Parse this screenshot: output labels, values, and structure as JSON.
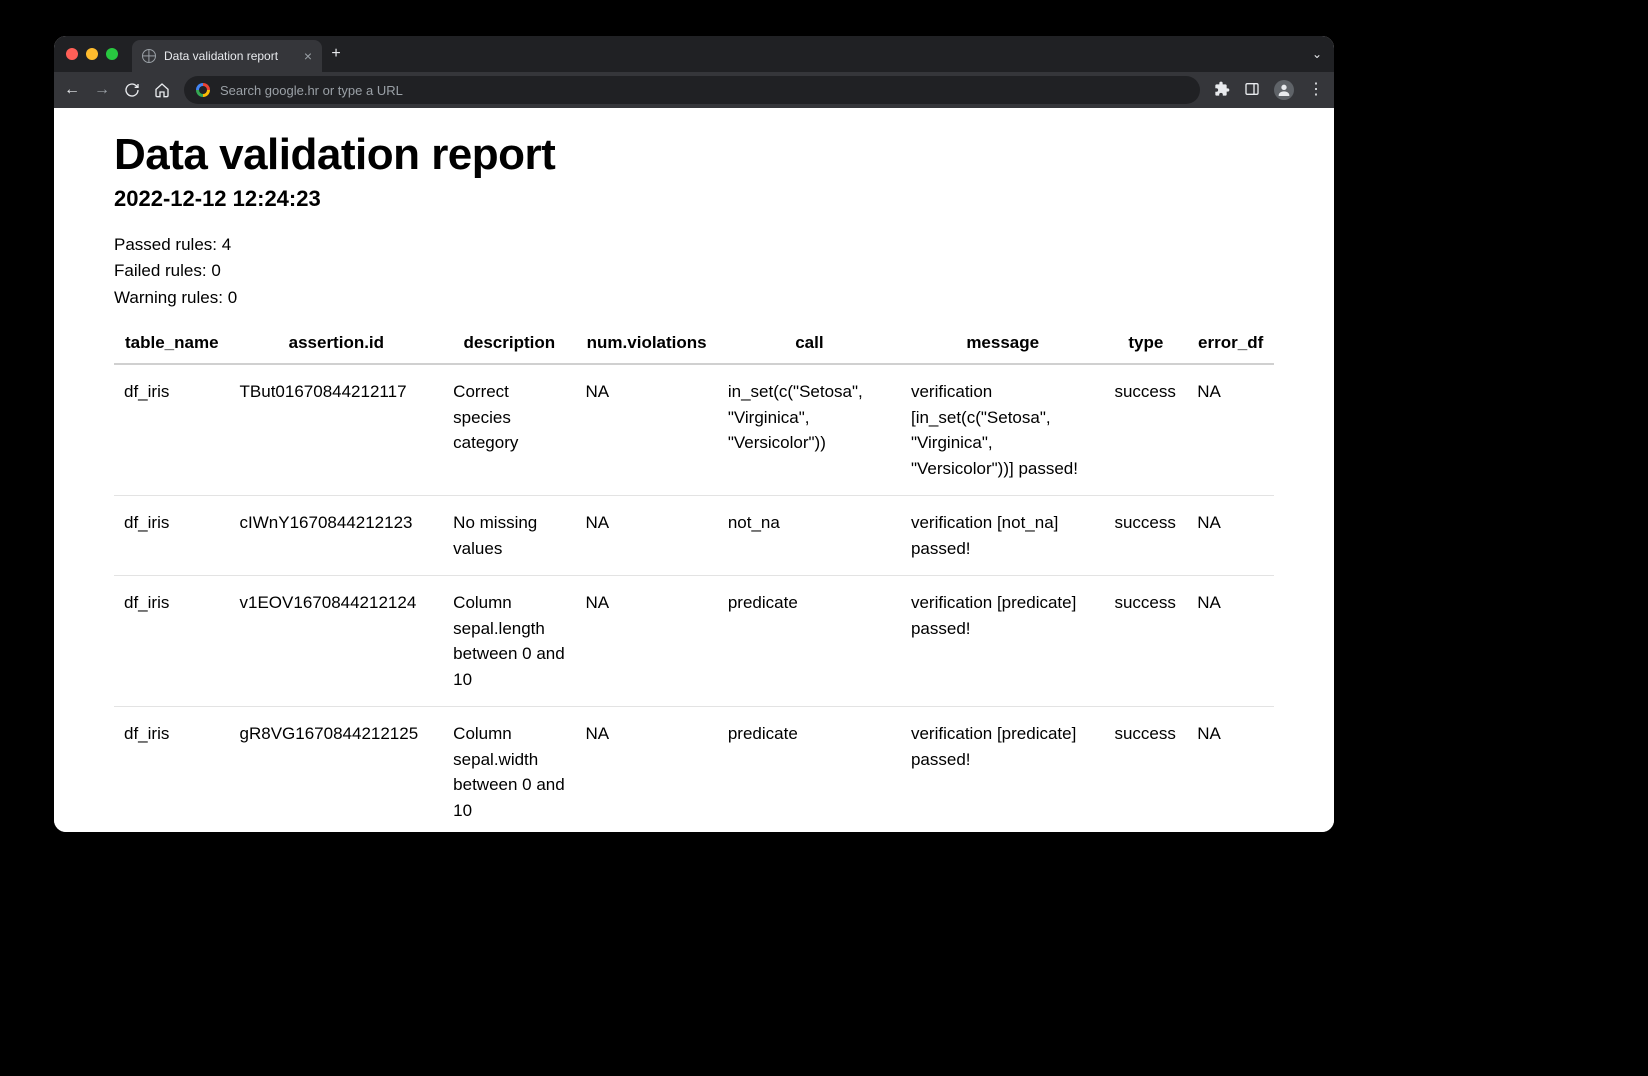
{
  "browser": {
    "tab_title": "Data validation report",
    "omnibox_placeholder": "Search google.hr or type a URL"
  },
  "report": {
    "title": "Data validation report",
    "timestamp": "2022-12-12 12:24:23",
    "summary": {
      "passed_label": "Passed rules: 4",
      "failed_label": "Failed rules: 0",
      "warning_label": "Warning rules: 0"
    },
    "columns": [
      "table_name",
      "assertion.id",
      "description",
      "num.violations",
      "call",
      "message",
      "type",
      "error_df"
    ],
    "rows": [
      {
        "table_name": "df_iris",
        "assertion_id": "TBut01670844212117",
        "description": "Correct species category",
        "num_violations": "NA",
        "call": "in_set(c(\"Setosa\", \"Virginica\", \"Versicolor\"))",
        "message": "verification [in_set(c(\"Setosa\", \"Virginica\", \"Versicolor\"))] passed!",
        "type": "success",
        "error_df": "NA"
      },
      {
        "table_name": "df_iris",
        "assertion_id": "cIWnY1670844212123",
        "description": "No missing values",
        "num_violations": "NA",
        "call": "not_na",
        "message": "verification [not_na] passed!",
        "type": "success",
        "error_df": "NA"
      },
      {
        "table_name": "df_iris",
        "assertion_id": "v1EOV1670844212124",
        "description": "Column sepal.length between 0 and 10",
        "num_violations": "NA",
        "call": "predicate",
        "message": "verification [predicate] passed!",
        "type": "success",
        "error_df": "NA"
      },
      {
        "table_name": "df_iris",
        "assertion_id": "gR8VG1670844212125",
        "description": "Column sepal.width between 0 and 10",
        "num_violations": "NA",
        "call": "predicate",
        "message": "verification [predicate] passed!",
        "type": "success",
        "error_df": "NA"
      }
    ]
  }
}
